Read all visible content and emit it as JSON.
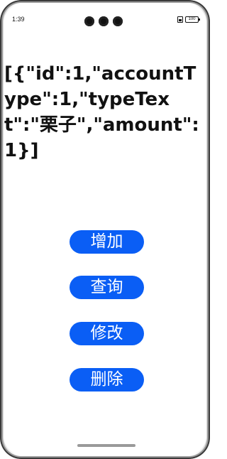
{
  "status_bar": {
    "time": "1:39",
    "battery": "100"
  },
  "content": {
    "json_text": "[{\"id\":1,\"accountType\":1,\"typeText\":\"栗子\",\"amount\":1}]"
  },
  "buttons": {
    "add": "增加",
    "query": "查询",
    "modify": "修改",
    "delete": "删除"
  },
  "colors": {
    "button_bg": "#0a5ef5",
    "button_text": "#ffffff",
    "text": "#111111"
  },
  "icons": [
    "camera-icon",
    "sim-icon",
    "battery-icon"
  ]
}
